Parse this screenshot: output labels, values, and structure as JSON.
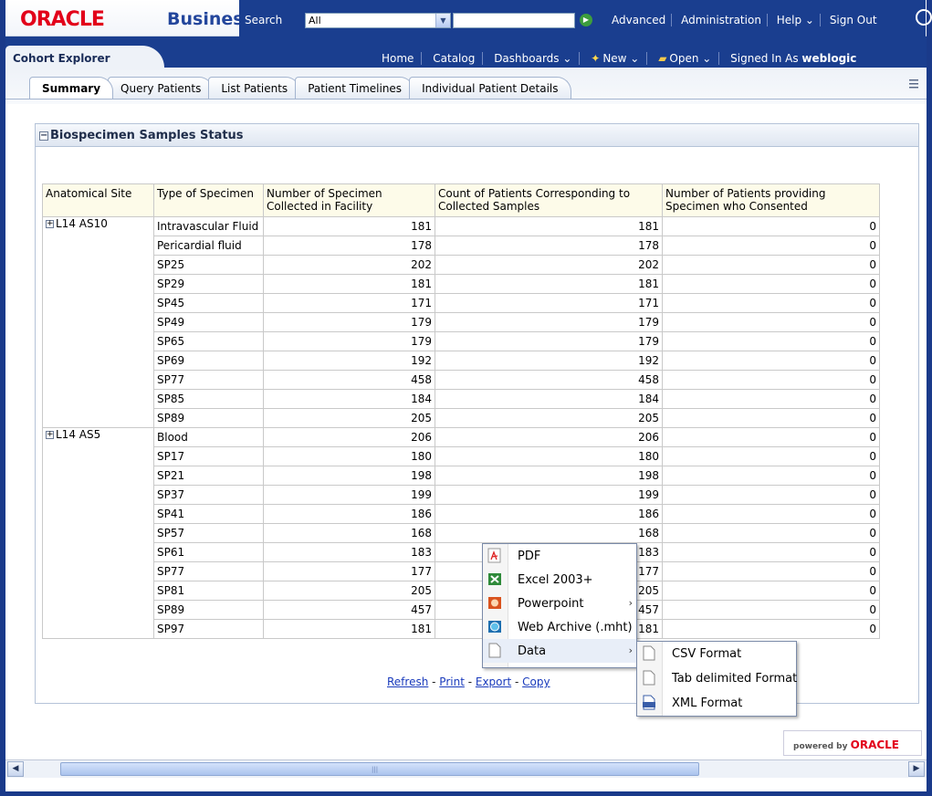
{
  "header": {
    "brand": "ORACLE",
    "app_name": "Business Intelligence",
    "search_label": "Search",
    "search_scope": "All",
    "top_links": [
      "Advanced",
      "Administration",
      "Help ⌄",
      "Sign Out"
    ]
  },
  "nav": {
    "dashboard_tab": "Cohort Explorer",
    "links": {
      "home": "Home",
      "catalog": "Catalog",
      "dashboards": "Dashboards ⌄",
      "new": "New ⌄",
      "open": "Open ⌄",
      "signed_in_as": "Signed In As",
      "user": "weblogic"
    }
  },
  "tabs": [
    "Summary",
    "Query Patients",
    "List Patients",
    "Patient Timelines",
    "Individual Patient Details"
  ],
  "panel": {
    "title": "Biospecimen Samples Status"
  },
  "table": {
    "columns": [
      "Anatomical Site",
      "Type of Specimen",
      "Number of Specimen Collected in Facility",
      "Count of Patients Corresponding to Collected Samples",
      "Number of Patients providing Specimen who Consented"
    ],
    "groups": [
      {
        "site": "L14 AS10",
        "rows": [
          [
            "Intravascular Fluid",
            "181",
            "181",
            "0"
          ],
          [
            "Pericardial fluid",
            "178",
            "178",
            "0"
          ],
          [
            "SP25",
            "202",
            "202",
            "0"
          ],
          [
            "SP29",
            "181",
            "181",
            "0"
          ],
          [
            "SP45",
            "171",
            "171",
            "0"
          ],
          [
            "SP49",
            "179",
            "179",
            "0"
          ],
          [
            "SP65",
            "179",
            "179",
            "0"
          ],
          [
            "SP69",
            "192",
            "192",
            "0"
          ],
          [
            "SP77",
            "458",
            "458",
            "0"
          ],
          [
            "SP85",
            "184",
            "184",
            "0"
          ],
          [
            "SP89",
            "205",
            "205",
            "0"
          ]
        ]
      },
      {
        "site": "L14 AS5",
        "rows": [
          [
            "Blood",
            "206",
            "206",
            "0"
          ],
          [
            "SP17",
            "180",
            "180",
            "0"
          ],
          [
            "SP21",
            "198",
            "198",
            "0"
          ],
          [
            "SP37",
            "199",
            "199",
            "0"
          ],
          [
            "SP41",
            "186",
            "186",
            "0"
          ],
          [
            "SP57",
            "168",
            "168",
            "0"
          ],
          [
            "SP61",
            "183",
            "183",
            "0"
          ],
          [
            "SP77",
            "177",
            "177",
            "0"
          ],
          [
            "SP81",
            "205",
            "205",
            "0"
          ],
          [
            "SP89",
            "457",
            "457",
            "0"
          ],
          [
            "SP97",
            "181",
            "181",
            "0"
          ]
        ]
      }
    ]
  },
  "footer_links": {
    "refresh": "Refresh",
    "print": "Print",
    "export": "Export",
    "copy": "Copy",
    "sep": " - "
  },
  "export_menu": [
    "PDF",
    "Excel 2003+",
    "Powerpoint",
    "Web Archive (.mht)",
    "Data"
  ],
  "data_submenu": [
    "CSV Format",
    "Tab delimited Format",
    "XML Format"
  ],
  "powered_by": {
    "prefix": "powered by",
    "brand": "ORACLE"
  },
  "colors": {
    "brand_red": "#e2001a",
    "header_blue": "#1a3e8f",
    "table_header": "#fdfbe9",
    "link": "#1a3bbc"
  }
}
